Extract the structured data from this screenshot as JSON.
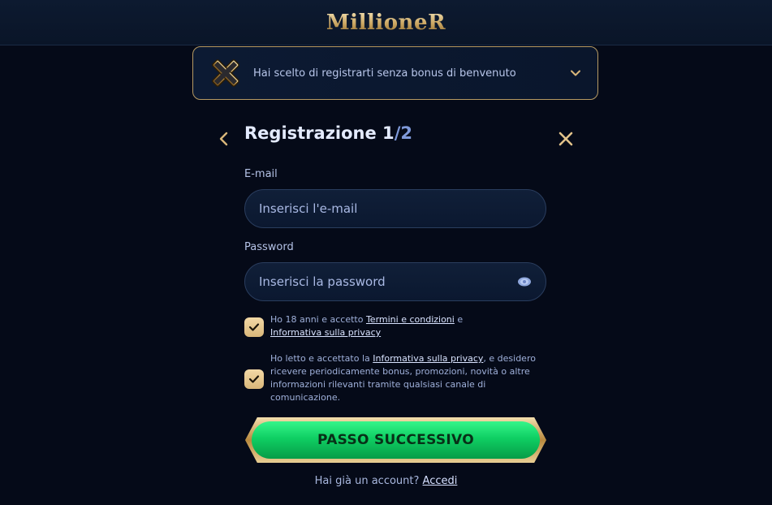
{
  "header": {
    "logo_text": "MillioneR"
  },
  "bonus_banner": {
    "text": "Hai scelto di registrarti senza bonus di benvenuto"
  },
  "registration": {
    "title": "Registrazione 1",
    "step_total": "/2",
    "email_label": "E-mail",
    "email_placeholder": "Inserisci l'e-mail",
    "password_label": "Password",
    "password_placeholder": "Inserisci la password"
  },
  "consents": {
    "terms_prefix": "Ho 18 anni e accetto ",
    "terms_link": "Termini e condizioni",
    "terms_middle": " e ",
    "privacy_link": "Informativa sulla privacy",
    "marketing_prefix": "Ho letto e accettato la ",
    "marketing_link": "Informativa sulla privacy",
    "marketing_suffix": ", e desidero ricevere periodicamente bonus, promozioni, novità o altre informazioni rilevanti tramite qualsiasi canale di comunicazione."
  },
  "cta": {
    "label": "PASSO SUCCESSIVO"
  },
  "login": {
    "prompt": "Hai già un account? ",
    "link": "Accedi"
  },
  "colors": {
    "gold": "#c9a460",
    "green": "#12d266",
    "background": "#050a18"
  }
}
